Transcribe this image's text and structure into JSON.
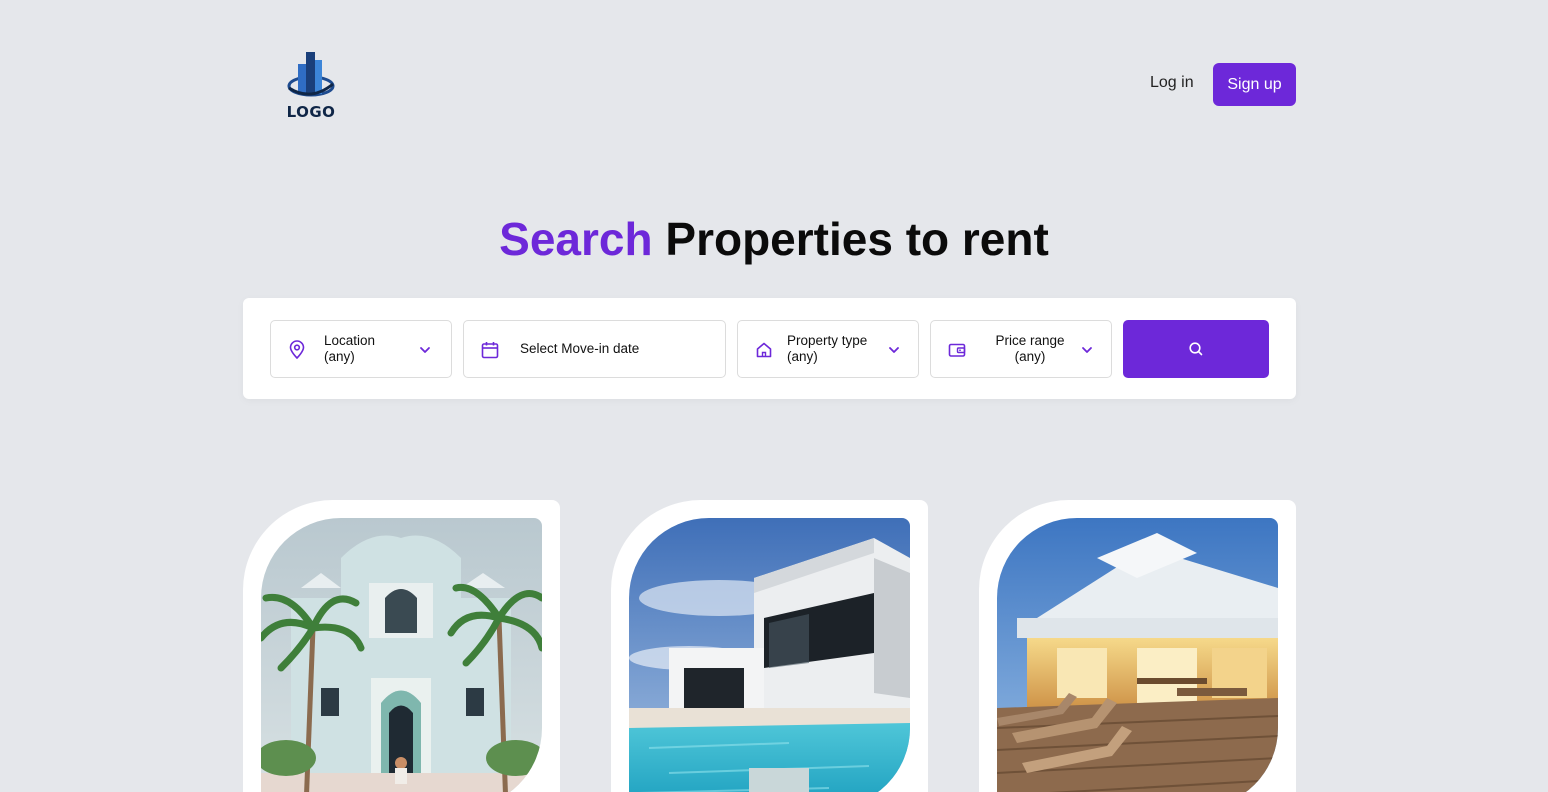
{
  "header": {
    "logo_text": "LOGO",
    "login_label": "Log in",
    "signup_label": "Sign up"
  },
  "hero": {
    "title_accent": "Search",
    "title_rest": "Properties to rent"
  },
  "search": {
    "location": {
      "line1": "Location",
      "line2": "(any)",
      "icon": "map-pin-icon"
    },
    "move_in": {
      "label": "Select Move-in date",
      "icon": "calendar-icon"
    },
    "property_type": {
      "line1": "Property type",
      "line2": "(any)",
      "icon": "home-icon"
    },
    "price_range": {
      "line1": "Price range",
      "line2": "(any)",
      "icon": "wallet-icon"
    },
    "button_icon": "search-icon"
  },
  "listings": [
    {
      "image": "white colonial house with palm trees"
    },
    {
      "image": "modern white villa with pool"
    },
    {
      "image": "beach house with lit deck and loungers"
    }
  ],
  "colors": {
    "accent": "#6d28d9",
    "background": "#e5e7eb",
    "text": "#0b0b0b"
  }
}
